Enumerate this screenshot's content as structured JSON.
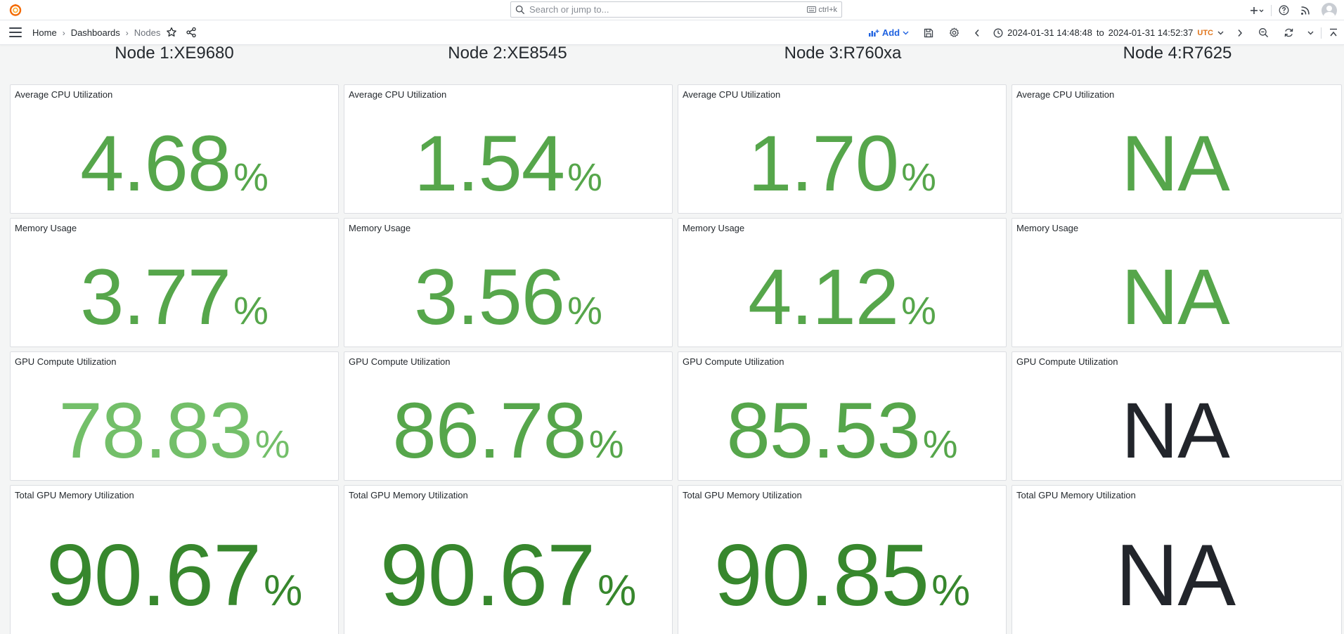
{
  "topbar": {
    "search_placeholder": "Search or jump to...",
    "search_shortcut": "ctrl+k",
    "icons": [
      "grafana-logo-icon",
      "search-icon",
      "keyboard-icon",
      "plus-icon",
      "help-icon",
      "news-icon",
      "user-avatar-icon"
    ]
  },
  "navbar": {
    "breadcrumbs": [
      "Home",
      "Dashboards",
      "Nodes"
    ],
    "add_label": "Add",
    "time_from": "2024-01-31 14:48:48",
    "time_to_word": "to",
    "time_to": "2024-01-31 14:52:37",
    "timezone": "UTC"
  },
  "nodes": [
    {
      "title": "Node 1:XE9680",
      "panels": [
        {
          "title": "Average CPU Utilization",
          "value": "4.68",
          "unit": "%",
          "color": "#56a64b"
        },
        {
          "title": "Memory Usage",
          "value": "3.77",
          "unit": "%",
          "color": "#56a64b"
        },
        {
          "title": "GPU Compute Utilization",
          "value": "78.83",
          "unit": "%",
          "color": "#73bf69"
        },
        {
          "title": "Total GPU Memory Utilization",
          "value": "90.67",
          "unit": "%",
          "color": "#37872d"
        }
      ]
    },
    {
      "title": "Node 2:XE8545",
      "panels": [
        {
          "title": "Average CPU Utilization",
          "value": "1.54",
          "unit": "%",
          "color": "#56a64b"
        },
        {
          "title": "Memory Usage",
          "value": "3.56",
          "unit": "%",
          "color": "#56a64b"
        },
        {
          "title": "GPU Compute Utilization",
          "value": "86.78",
          "unit": "%",
          "color": "#56a64b"
        },
        {
          "title": "Total GPU Memory Utilization",
          "value": "90.67",
          "unit": "%",
          "color": "#37872d"
        }
      ]
    },
    {
      "title": "Node 3:R760xa",
      "panels": [
        {
          "title": "Average CPU Utilization",
          "value": "1.70",
          "unit": "%",
          "color": "#56a64b"
        },
        {
          "title": "Memory Usage",
          "value": "4.12",
          "unit": "%",
          "color": "#56a64b"
        },
        {
          "title": "GPU Compute Utilization",
          "value": "85.53",
          "unit": "%",
          "color": "#56a64b"
        },
        {
          "title": "Total GPU Memory Utilization",
          "value": "90.85",
          "unit": "%",
          "color": "#37872d"
        }
      ]
    },
    {
      "title": "Node 4:R7625",
      "panels": [
        {
          "title": "Average CPU Utilization",
          "value": "NA",
          "unit": "",
          "color": "#56a64b"
        },
        {
          "title": "Memory Usage",
          "value": "NA",
          "unit": "",
          "color": "#56a64b"
        },
        {
          "title": "GPU Compute Utilization",
          "value": "NA",
          "unit": "",
          "color": "#22252b"
        },
        {
          "title": "Total GPU Memory Utilization",
          "value": "NA",
          "unit": "",
          "color": "#22252b"
        }
      ]
    }
  ]
}
